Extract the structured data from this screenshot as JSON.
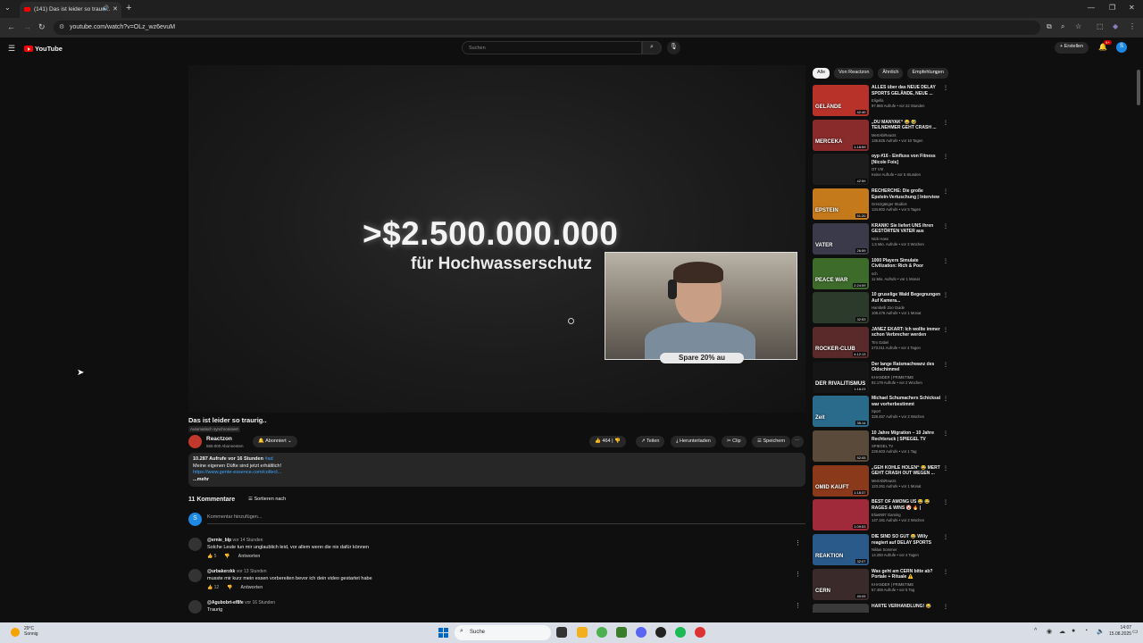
{
  "browser": {
    "tab_title": "(141) Das ist leider so trauri...",
    "url": "youtube.com/watch?v=OLz_wz6evuM"
  },
  "header": {
    "logo_text": "YouTube",
    "search_placeholder": "Suchen",
    "create_label": "Erstellen",
    "notification_count": "9+",
    "user_initial": "S"
  },
  "player": {
    "amount_text": ">$2.500.000.000",
    "subtitle_text": "für Hochwasserschutz",
    "promo_text": "Spare 20% au"
  },
  "video": {
    "title": "Das ist leider so traurig..",
    "auto_badge": "Automatisch synchronisiert",
    "channel_name": "Reactzon",
    "channel_subs": "559.000 Abonnenten",
    "subscribe_label": "Abonniert",
    "likes": "464",
    "share_label": "Teilen",
    "download_label": "Herunterladen",
    "clip_label": "Clip",
    "save_label": "Speichern",
    "desc_stats": "10.287 Aufrufe  vor 16 Stunden",
    "desc_tag": "#ad",
    "desc_line": "Meine eigenen Düfte sind jetzt erhältlich!",
    "desc_link": "https://www.gente-essence.com/collect...",
    "desc_more": "...mehr"
  },
  "comments": {
    "count_label": "11 Kommentare",
    "sort_label": "Sortieren nach",
    "placeholder": "Kommentar hinzufügen...",
    "my_initial": "S",
    "reply_label": "Antworten",
    "items": [
      {
        "author": "@ernie_blp",
        "time": "vor 14 Stunden",
        "text": "Solche Leute tun mir unglaublich leid, vor allem wenn die nix dafür können",
        "likes": "5"
      },
      {
        "author": "@urbakerzkk",
        "time": "vor 13 Stunden",
        "text": "musste mir kurz mein essen vorbereiten bevor ich dein video gestartet habe",
        "likes": "12"
      },
      {
        "author": "@Agubobrt-ef8fe",
        "time": "vor 16 Stunden",
        "text": "Traurig",
        "likes": ""
      }
    ]
  },
  "sidebar": {
    "chips": [
      "Alle",
      "Von Reactzon",
      "Ähnlich",
      "Empfehlungen"
    ],
    "items": [
      {
        "title": "ALLES über das NEUE DELAY SPORTS GELÄNDE, NEUE ...",
        "channel": "Eligella",
        "stats": "97.866 Aufrufe • vor 22 Stunden",
        "duration": "42:40",
        "thumb_text": "GELÄNDE",
        "color": "#b8322a"
      },
      {
        "title": "„DU MANYAK“ 😂 🤣 TEILNEHMER GEHT CRASH ...",
        "channel": "MertAbiReacts",
        "stats": "136.825 Aufrufe • vor 10 Tagen",
        "duration": "1:18:59",
        "thumb_text": "MERCEKA",
        "color": "#8a2b2b"
      },
      {
        "title": "oyp #16 - Einfluss von Fitness [Nicole Fois]",
        "channel": "OT VIII",
        "stats": "Keine Aufrufe • vor 5 Stunden",
        "duration": "42:59",
        "thumb_text": "",
        "color": "#1c1c1c"
      },
      {
        "title": "RECHERCHE: Die große Epstein-Vertuschung | Interview mit ...",
        "channel": "Grenzgänger Studios",
        "stats": "134.802 Aufrufe • vor 5 Tagen",
        "duration": "51:20",
        "thumb_text": "EPSTEIN",
        "color": "#c47a1a"
      },
      {
        "title": "KRANK! Sie liefert UNS ihren GESTÖRTEN VATER aus",
        "channel": "Nick Hass",
        "stats": "1,5 Mio. Aufrufe • vor 3 Wochen",
        "duration": "26:59",
        "thumb_text": "VATER",
        "color": "#3a3a4a"
      },
      {
        "title": "1000 Players Simulate Civilization: Rich & Poor",
        "channel": "sch",
        "stats": "11 Mio. Aufrufe • vor 1 Monat",
        "duration": "2:24:09",
        "thumb_text": "PEACE WAR",
        "color": "#3d6b2a"
      },
      {
        "title": "10 gruselige Wald Begegnungen Auf Kamera...",
        "channel": "Hambelli Zoo Guide",
        "stats": "108.476 Aufrufe • vor 1 Monat",
        "duration": "32:53",
        "thumb_text": "",
        "color": "#2c3a2c"
      },
      {
        "title": "JANEZ EKART: Ich wollte immer schon Verbrecher werden",
        "channel": "Tim Gabel",
        "stats": "273.011 Aufrufe • vor 4 Tagen",
        "duration": "4:12:13",
        "thumb_text": "ROCKER-CLUB",
        "color": "#5a2a2a"
      },
      {
        "title": "Der lange Ratsmachwanz des Oldschimmel",
        "channel": "KHANDER | PRIMETIME",
        "stats": "92.179 Aufrufe • vor 2 Wochen",
        "duration": "1:18:23",
        "thumb_text": "DER RIVALITISMUS",
        "color": "#151515"
      },
      {
        "title": "Michael Schumachers Schicksal war vorherbestimmt",
        "channel": "Sport",
        "stats": "328.467 Aufrufe • vor 2 Wochen",
        "duration": "35:14",
        "thumb_text": "Zeit",
        "color": "#2a6a8a"
      },
      {
        "title": "10 Jahre Migration – 10 Jahre Rechtsruck | SPIEGEL TV",
        "channel": "SPIEGEL TV",
        "stats": "229.603 Aufrufe • vor 1 Tag",
        "duration": "52:05",
        "thumb_text": "",
        "color": "#5a4a3a"
      },
      {
        "title": "„GEH KOHLE HOLEN“ 😂 MERT GEHT CRASH OUT WEGEN ...",
        "channel": "MertAbiReacts",
        "stats": "123.261 Aufrufe • vor 1 Monat",
        "duration": "1:18:37",
        "thumb_text": "OMID KAUFT",
        "color": "#8a3a1a"
      },
      {
        "title": "BEST OF AMONG US 😂 😂 RAGES & WINS 🤡 🔥 | EliasN9...",
        "channel": "EliasN97 Gaming",
        "stats": "147.181 Aufrufe • vor 2 Wochen",
        "duration": "1:09:53",
        "thumb_text": "",
        "color": "#a02a3a"
      },
      {
        "title": "DIE SIND SO GUT 😂 Willy reagiert auf DELAY SPORTS vs...",
        "channel": "Niklas Sommer",
        "stats": "14.250 Aufrufe • vor 4 Tagen",
        "duration": "32:07",
        "thumb_text": "REAKTION",
        "color": "#2a5a8a"
      },
      {
        "title": "Was geht am CERN bitte ab? Portale + Rituale ⚠️",
        "channel": "KHANDER | PRIMETIME",
        "stats": "57.408 Aufrufe • vor 5 Tag",
        "duration": "40:05",
        "thumb_text": "CERN",
        "color": "#3a2a2a"
      },
      {
        "title": "HARTE VERHANDLUNG! 😂",
        "channel": "",
        "stats": "",
        "duration": "",
        "thumb_text": "",
        "color": "#3a3a3a"
      }
    ]
  },
  "taskbar": {
    "temperature": "29°C",
    "condition": "Sonnig",
    "search_label": "Suche",
    "time": "14:07",
    "date": "15.08.2025"
  },
  "colors": {
    "background": "#0f0f0f",
    "accent_red": "#ff0000",
    "link_blue": "#3ea6ff"
  }
}
